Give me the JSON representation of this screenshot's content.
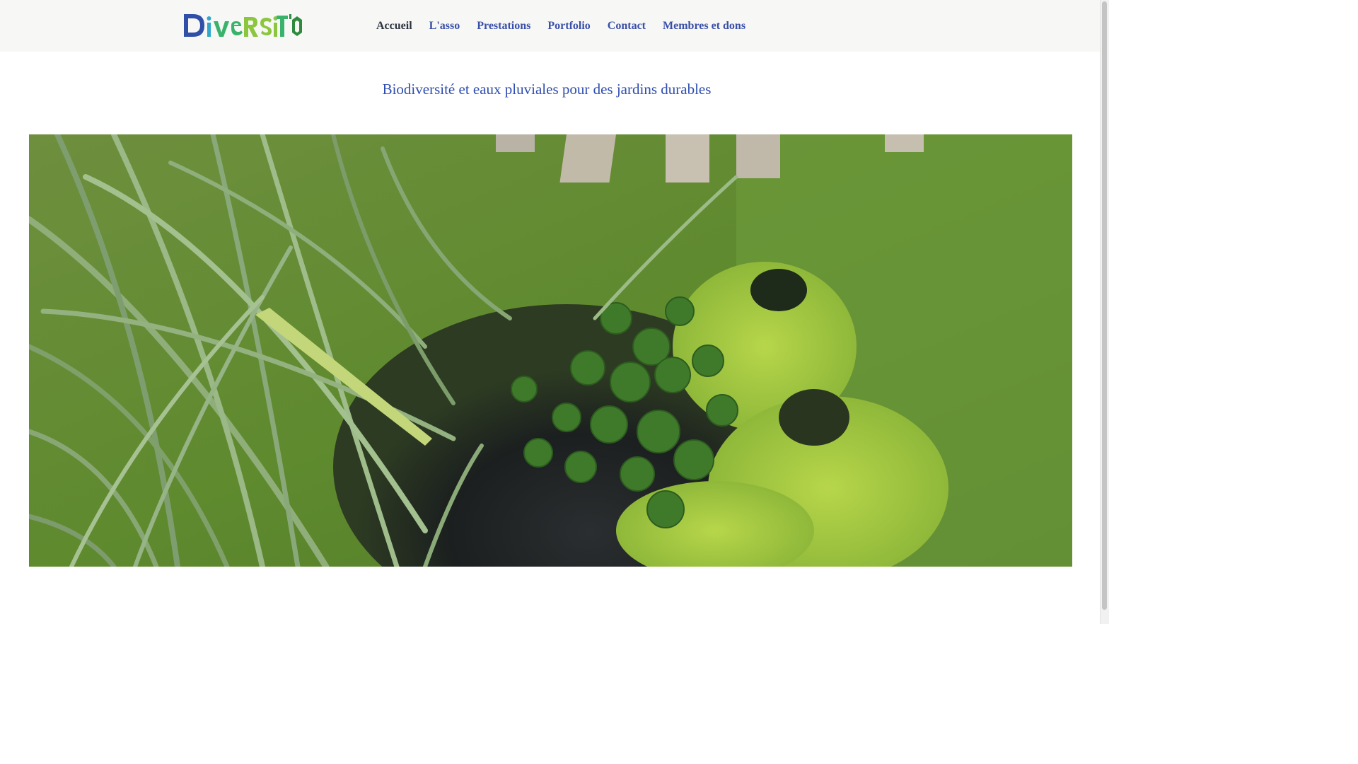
{
  "brand": {
    "logo_text": "DiVeRSiT'O",
    "colors": {
      "d_blue": "#2f4fa8",
      "i_teal": "#2fa8c9",
      "ve_green": "#39b36b",
      "rs_lime": "#8cc63f",
      "o_green": "#2e8b3e"
    }
  },
  "nav": {
    "items": [
      {
        "label": "Accueil",
        "active": true
      },
      {
        "label": "L'asso"
      },
      {
        "label": "Prestations"
      },
      {
        "label": "Portfolio"
      },
      {
        "label": "Contact"
      },
      {
        "label": "Membres et dons"
      }
    ]
  },
  "main": {
    "subtitle": "Biodiversité et eaux pluviales pour des jardins durables",
    "hero_image": {
      "description_icon": "pond-garden-photo"
    }
  },
  "colors": {
    "nav_link": "#3a4fa8",
    "nav_active": "#2e3440",
    "subtitle": "#2f4db0",
    "header_bg": "#f7f8f6"
  }
}
